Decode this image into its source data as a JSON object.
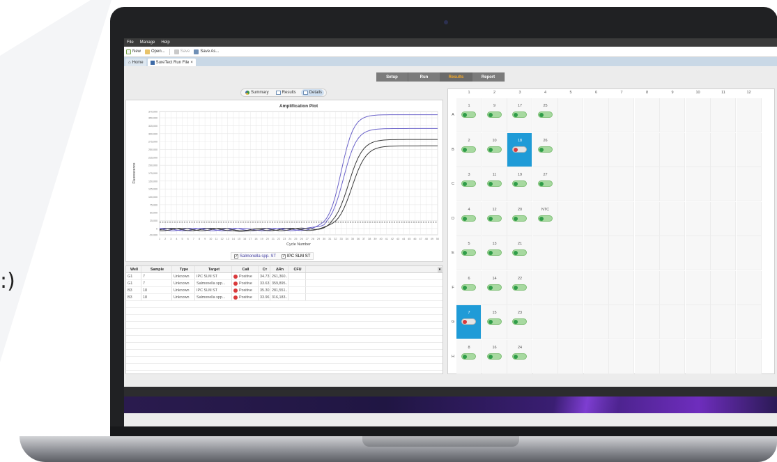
{
  "side_glyph": ":)",
  "colors": {
    "accent_active_mode": "#f3a92b",
    "selected_well": "#1f9bd7",
    "positive": "#d9393b",
    "negative": "#2f9d48",
    "line_salmonella": "#6b63c9",
    "line_ipc": "#3a3a3a"
  },
  "menu": [
    "File",
    "Manage",
    "Help"
  ],
  "toolbar": {
    "new": "New",
    "open": "Open...",
    "save": "Save",
    "save_as": "Save As..."
  },
  "tabs": [
    {
      "label": "Home",
      "icon": "home-icon"
    },
    {
      "label": "SureTect Run File",
      "icon": "run-file-icon",
      "close": "×"
    }
  ],
  "modes": [
    "Setup",
    "Run",
    "Results",
    "Report"
  ],
  "active_mode": "Results",
  "view_toggle": {
    "summary": "Summary",
    "results": "Results",
    "details": "Details"
  },
  "chart_data": {
    "type": "line",
    "title": "Amplification Plot",
    "xlabel": "Cycle Number",
    "ylabel": "Fluorescence",
    "xlim": [
      1,
      50
    ],
    "ylim": [
      -20000,
      370000
    ],
    "x_ticks": [
      "1",
      "2",
      "3",
      "4",
      "5",
      "6",
      "7",
      "8",
      "9",
      "10",
      "11",
      "12",
      "13",
      "14",
      "15",
      "16",
      "17",
      "18",
      "19",
      "20",
      "21",
      "22",
      "23",
      "24",
      "25",
      "26",
      "27",
      "28",
      "29",
      "30",
      "31",
      "32",
      "33",
      "34",
      "35",
      "36",
      "37",
      "38",
      "39",
      "40",
      "41",
      "42",
      "43",
      "44",
      "45",
      "46",
      "47",
      "48",
      "49",
      "50"
    ],
    "y_ticks": [
      "370,000",
      "350,000",
      "325,000",
      "300,000",
      "275,000",
      "250,000",
      "225,000",
      "200,000",
      "175,000",
      "150,000",
      "125,000",
      "100,000",
      "75,000",
      "50,000",
      "25,000",
      "0",
      "-20,000"
    ],
    "grid": true,
    "threshold": 20000,
    "series": [
      {
        "name": "Salmonella spp. ST",
        "color": "#6b63c9",
        "plateau": 359895,
        "midpoint": 33.0,
        "slope": 0.9
      },
      {
        "name": "Salmonella spp. ST",
        "color": "#6b63c9",
        "plateau": 316183,
        "midpoint": 33.4,
        "slope": 0.85
      },
      {
        "name": "IPC SLM ST",
        "color": "#3a3a3a",
        "plateau": 281551,
        "midpoint": 34.3,
        "slope": 0.8
      },
      {
        "name": "IPC SLM ST",
        "color": "#3a3a3a",
        "plateau": 261360,
        "midpoint": 34.9,
        "slope": 0.8
      }
    ],
    "legend": [
      "Salmonella spp. ST",
      "IPC SLM ST"
    ]
  },
  "table": {
    "columns": [
      "Well",
      "Sample",
      "Type",
      "Target",
      "Call",
      "Cт",
      "ΔRn",
      "CFU"
    ],
    "rows": [
      [
        "G1",
        "7",
        "Unknown",
        "IPC SLM ST",
        "Positive",
        "34.73",
        "261,360...",
        ""
      ],
      [
        "G1",
        "7",
        "Unknown",
        "Salmonella spp...",
        "Positive",
        "33.63",
        "359,895...",
        ""
      ],
      [
        "B3",
        "18",
        "Unknown",
        "IPC SLM ST",
        "Positive",
        "35.30",
        "281,551...",
        ""
      ],
      [
        "B3",
        "18",
        "Unknown",
        "Salmonella spp...",
        "Positive",
        "33.96",
        "316,183...",
        ""
      ]
    ],
    "empty_rows": 10
  },
  "plate": {
    "columns": [
      "1",
      "2",
      "3",
      "4",
      "5",
      "6",
      "7",
      "8",
      "9",
      "10",
      "11",
      "12"
    ],
    "rows": [
      "A",
      "B",
      "C",
      "D",
      "E",
      "F",
      "G",
      "H"
    ],
    "wells": [
      {
        "row": 0,
        "col": 0,
        "label": "1",
        "status": "negative"
      },
      {
        "row": 0,
        "col": 1,
        "label": "9",
        "status": "negative"
      },
      {
        "row": 0,
        "col": 2,
        "label": "17",
        "status": "negative"
      },
      {
        "row": 0,
        "col": 3,
        "label": "25",
        "status": "negative"
      },
      {
        "row": 1,
        "col": 0,
        "label": "2",
        "status": "negative"
      },
      {
        "row": 1,
        "col": 1,
        "label": "10",
        "status": "negative"
      },
      {
        "row": 1,
        "col": 2,
        "label": "18",
        "status": "positive",
        "selected": true
      },
      {
        "row": 1,
        "col": 3,
        "label": "26",
        "status": "negative"
      },
      {
        "row": 2,
        "col": 0,
        "label": "3",
        "status": "negative"
      },
      {
        "row": 2,
        "col": 1,
        "label": "11",
        "status": "negative"
      },
      {
        "row": 2,
        "col": 2,
        "label": "19",
        "status": "negative"
      },
      {
        "row": 2,
        "col": 3,
        "label": "27",
        "status": "negative"
      },
      {
        "row": 3,
        "col": 0,
        "label": "4",
        "status": "negative"
      },
      {
        "row": 3,
        "col": 1,
        "label": "12",
        "status": "negative"
      },
      {
        "row": 3,
        "col": 2,
        "label": "20",
        "status": "negative"
      },
      {
        "row": 3,
        "col": 3,
        "label": "NTC",
        "status": "negative"
      },
      {
        "row": 4,
        "col": 0,
        "label": "5",
        "status": "negative"
      },
      {
        "row": 4,
        "col": 1,
        "label": "13",
        "status": "negative"
      },
      {
        "row": 4,
        "col": 2,
        "label": "21",
        "status": "negative"
      },
      {
        "row": 5,
        "col": 0,
        "label": "6",
        "status": "negative"
      },
      {
        "row": 5,
        "col": 1,
        "label": "14",
        "status": "negative"
      },
      {
        "row": 5,
        "col": 2,
        "label": "22",
        "status": "negative"
      },
      {
        "row": 6,
        "col": 0,
        "label": "7",
        "status": "positive",
        "selected": true
      },
      {
        "row": 6,
        "col": 1,
        "label": "15",
        "status": "negative"
      },
      {
        "row": 6,
        "col": 2,
        "label": "23",
        "status": "negative"
      },
      {
        "row": 7,
        "col": 0,
        "label": "8",
        "status": "negative"
      },
      {
        "row": 7,
        "col": 1,
        "label": "16",
        "status": "negative"
      },
      {
        "row": 7,
        "col": 2,
        "label": "24",
        "status": "negative"
      }
    ]
  }
}
